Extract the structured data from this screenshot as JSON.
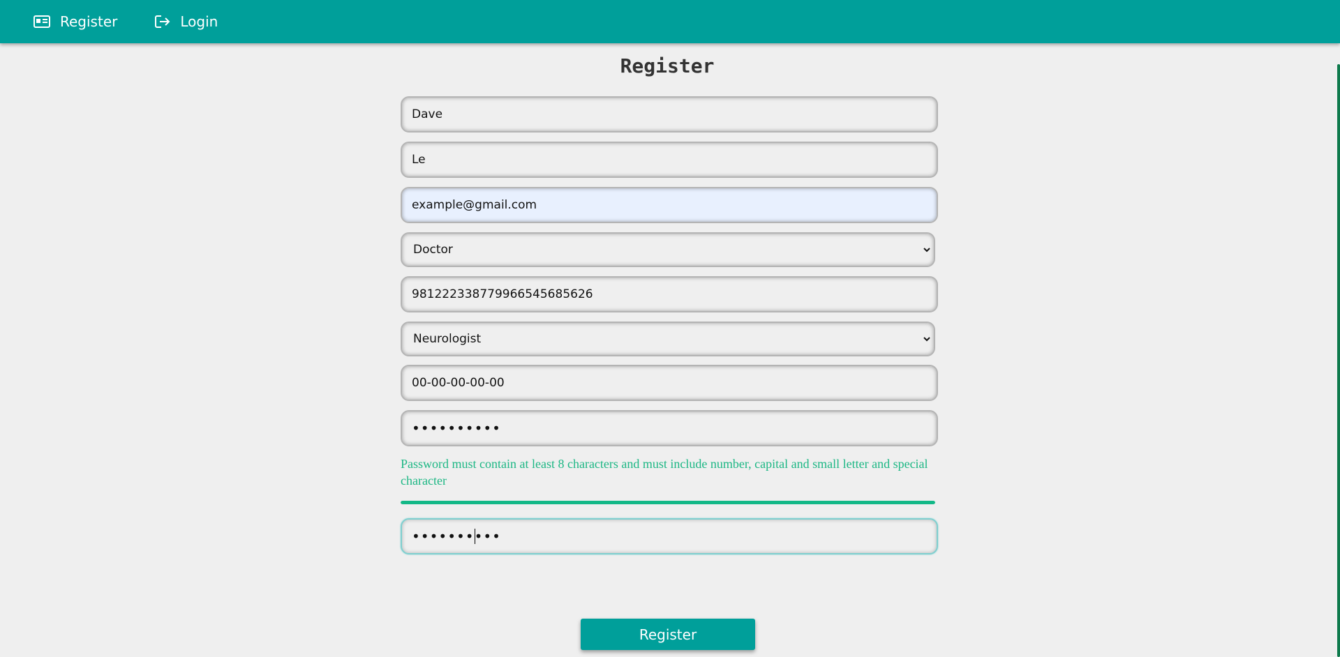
{
  "nav": {
    "register_label": "Register",
    "login_label": "Login"
  },
  "form": {
    "title": "Register",
    "first_name": "Dave",
    "last_name": "Le",
    "email": "example@gmail.com",
    "role": {
      "selected": "Doctor",
      "options": [
        "Doctor"
      ]
    },
    "id_number": "98122233877996654568562​6",
    "specialty": {
      "selected": "Neurologist",
      "options": [
        "Neurologist"
      ]
    },
    "phone": "00-00-00-00-00",
    "password": "••••••••••",
    "password_hint": "Password must contain at least 8 characters and must include number, capital and small letter and special character",
    "password_strength": 1.0,
    "confirm_password": "••••••••••",
    "submit_label": "Register"
  },
  "colors": {
    "brand": "#009f9a",
    "hint": "#1cb784",
    "strength": "#13b887"
  }
}
